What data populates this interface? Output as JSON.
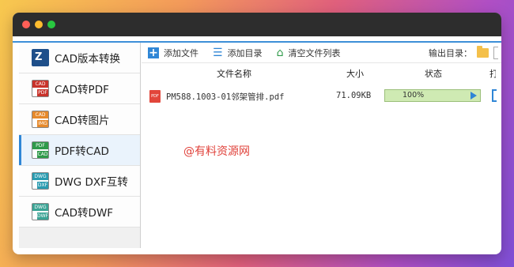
{
  "sidebar": {
    "items": [
      {
        "label": "CAD版本转换",
        "icon": "cad-version-icon",
        "active": false
      },
      {
        "label": "CAD转PDF",
        "icon": "cad-to-pdf-icon",
        "active": false
      },
      {
        "label": "CAD转图片",
        "icon": "cad-to-image-icon",
        "active": false
      },
      {
        "label": "PDF转CAD",
        "icon": "pdf-to-cad-icon",
        "active": true
      },
      {
        "label": "DWG DXF互转",
        "icon": "dwg-dxf-icon",
        "active": false
      },
      {
        "label": "CAD转DWF",
        "icon": "cad-to-dwf-icon",
        "active": false
      }
    ]
  },
  "toolbar": {
    "add_file": "添加文件",
    "add_dir": "添加目录",
    "clear_list": "清空文件列表",
    "output_dir_label": "输出目录："
  },
  "table": {
    "headers": {
      "name": "文件名称",
      "size": "大小",
      "status": "状态",
      "op": "打"
    },
    "rows": [
      {
        "name": "PM588.1003-01邻架管排.pdf",
        "size": "71.09KB",
        "progress_text": "100%",
        "progress": 100
      }
    ]
  },
  "watermark": "@有料资源网",
  "colors": {
    "accent": "#2f86d6",
    "progress": "#cfeab3",
    "watermark": "#e0413a"
  }
}
